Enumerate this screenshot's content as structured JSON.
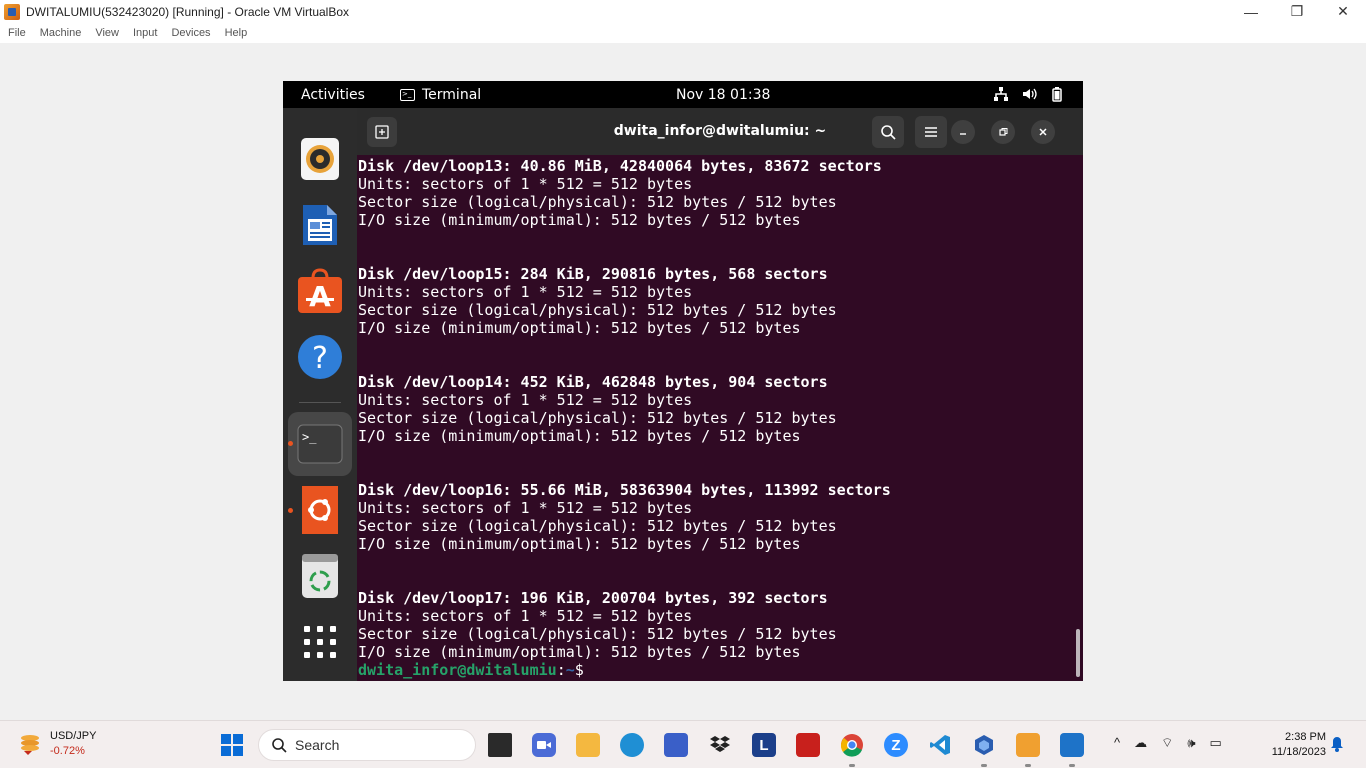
{
  "host_window": {
    "title": "DWITALUMIU(532423020) [Running] - Oracle VM VirtualBox",
    "menu": [
      "File",
      "Machine",
      "View",
      "Input",
      "Devices",
      "Help"
    ],
    "controls": {
      "minimize": "—",
      "restore": "❐",
      "close": "✕"
    }
  },
  "guest": {
    "topbar": {
      "activities": "Activities",
      "app_name": "Terminal",
      "app_icon": ">_",
      "clock": "Nov 18  01:38",
      "tray_icons": [
        "network-icon",
        "volume-icon",
        "battery-icon"
      ]
    },
    "dock": {
      "items": [
        "rhythmbox-icon",
        "libreoffice-writer-icon",
        "app-center-icon",
        "help-icon",
        "terminal-icon",
        "ubuntu-installer-icon",
        "trash-icon",
        "show-apps-icon"
      ],
      "help_glyph": "?",
      "terminal_glyph": ">_"
    },
    "terminal": {
      "title": "dwita_infor@dwitalumiu: ~",
      "lines": [
        {
          "text": "Disk /dev/loop13: 40.86 MiB, 42840064 bytes, 83672 sectors",
          "bold": true
        },
        {
          "text": "Units: sectors of 1 * 512 = 512 bytes",
          "bold": false
        },
        {
          "text": "Sector size (logical/physical): 512 bytes / 512 bytes",
          "bold": false
        },
        {
          "text": "I/O size (minimum/optimal): 512 bytes / 512 bytes",
          "bold": false
        },
        {
          "text": "",
          "bold": false
        },
        {
          "text": "",
          "bold": false
        },
        {
          "text": "Disk /dev/loop15: 284 KiB, 290816 bytes, 568 sectors",
          "bold": true
        },
        {
          "text": "Units: sectors of 1 * 512 = 512 bytes",
          "bold": false
        },
        {
          "text": "Sector size (logical/physical): 512 bytes / 512 bytes",
          "bold": false
        },
        {
          "text": "I/O size (minimum/optimal): 512 bytes / 512 bytes",
          "bold": false
        },
        {
          "text": "",
          "bold": false
        },
        {
          "text": "",
          "bold": false
        },
        {
          "text": "Disk /dev/loop14: 452 KiB, 462848 bytes, 904 sectors",
          "bold": true
        },
        {
          "text": "Units: sectors of 1 * 512 = 512 bytes",
          "bold": false
        },
        {
          "text": "Sector size (logical/physical): 512 bytes / 512 bytes",
          "bold": false
        },
        {
          "text": "I/O size (minimum/optimal): 512 bytes / 512 bytes",
          "bold": false
        },
        {
          "text": "",
          "bold": false
        },
        {
          "text": "",
          "bold": false
        },
        {
          "text": "Disk /dev/loop16: 55.66 MiB, 58363904 bytes, 113992 sectors",
          "bold": true
        },
        {
          "text": "Units: sectors of 1 * 512 = 512 bytes",
          "bold": false
        },
        {
          "text": "Sector size (logical/physical): 512 bytes / 512 bytes",
          "bold": false
        },
        {
          "text": "I/O size (minimum/optimal): 512 bytes / 512 bytes",
          "bold": false
        },
        {
          "text": "",
          "bold": false
        },
        {
          "text": "",
          "bold": false
        },
        {
          "text": "Disk /dev/loop17: 196 KiB, 200704 bytes, 392 sectors",
          "bold": true
        },
        {
          "text": "Units: sectors of 1 * 512 = 512 bytes",
          "bold": false
        },
        {
          "text": "Sector size (logical/physical): 512 bytes / 512 bytes",
          "bold": false
        },
        {
          "text": "I/O size (minimum/optimal): 512 bytes / 512 bytes",
          "bold": false
        }
      ],
      "prompt": {
        "user": "dwita_infor@dwitalumiu",
        "sep": ":",
        "path": "~",
        "symbol": "$"
      }
    }
  },
  "taskbar": {
    "widget": {
      "title": "USD/JPY",
      "change": "-0.72%"
    },
    "search_placeholder": "Search",
    "apps": [
      "task-view-icon",
      "meet-icon",
      "file-explorer-icon",
      "edge-icon",
      "store-icon",
      "dropbox-icon",
      "l-app-icon",
      "mcafee-icon",
      "chrome-icon",
      "zoom-icon",
      "vscode-icon",
      "virtualbox-icon",
      "sketch-app-icon",
      "photos-icon"
    ],
    "letters": {
      "l_app": "L",
      "zoom": "Z"
    },
    "tray": {
      "chevron": "^",
      "cloud": "☁",
      "wifi": "⌔",
      "volume": "🕪",
      "battery": "▭"
    },
    "time": "2:38 PM",
    "date": "11/18/2023"
  },
  "colors": {
    "terminal_bg": "#300a24",
    "prompt_user": "#26a269",
    "prompt_path": "#3465a4",
    "ubuntu_orange": "#e95420"
  }
}
